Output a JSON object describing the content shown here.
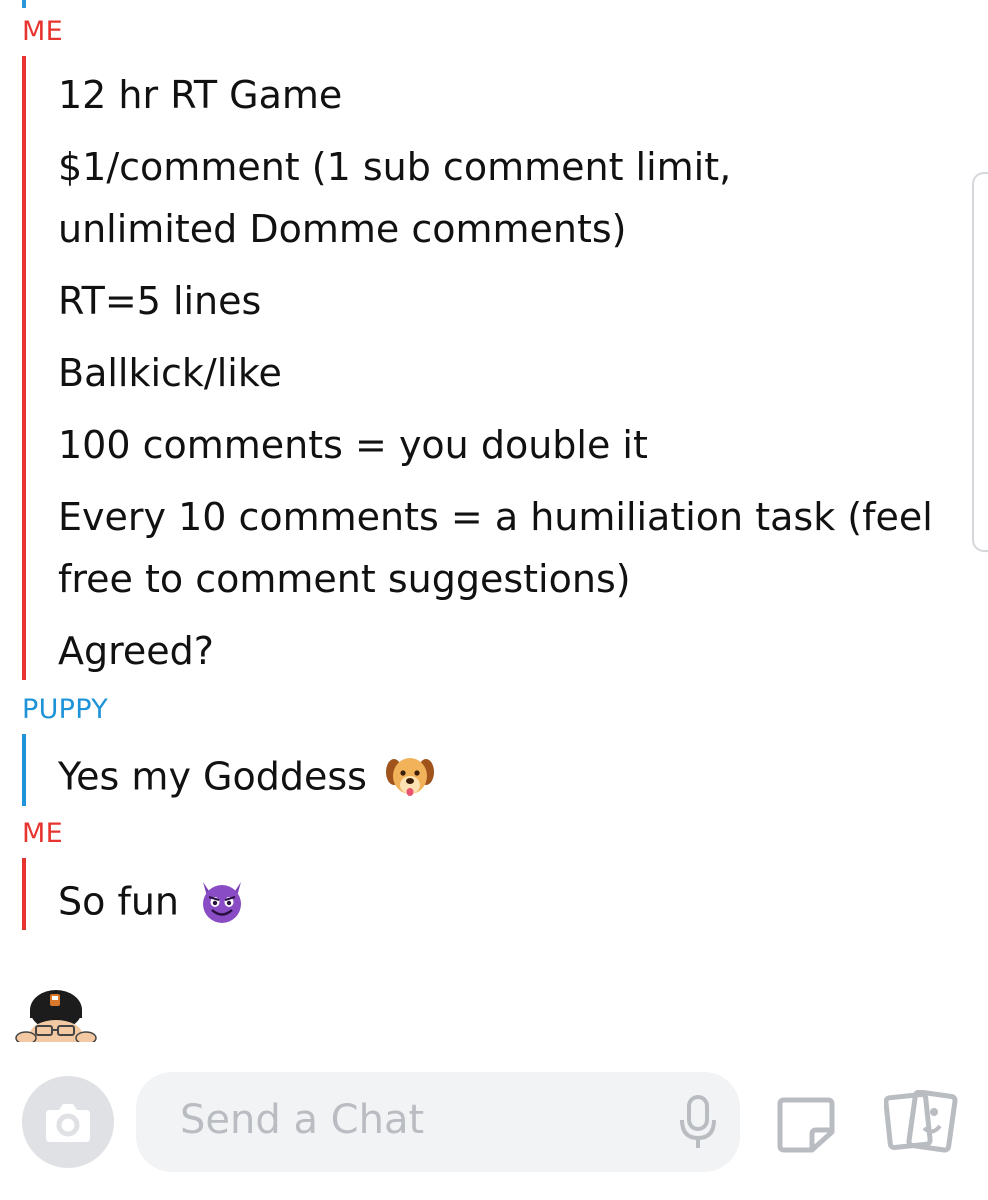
{
  "conversation": {
    "groups": [
      {
        "sender": "ME",
        "lines": [
          "12 hr RT Game",
          "$1/comment (1 sub comment limit,",
          "unlimited Domme comments)",
          "RT=5 lines",
          "Ballkick/like",
          "100 comments = you double it",
          "Every 10 comments = a humiliation task (feel",
          "free to comment suggestions)",
          "Agreed?"
        ]
      },
      {
        "sender": "PUPPY",
        "lines": [
          "Yes my Goddess"
        ],
        "emoji": "dog-face-emoji"
      },
      {
        "sender": "ME",
        "lines": [
          "So fun"
        ],
        "emoji": "smiling-devil-emoji"
      }
    ]
  },
  "composer": {
    "placeholder": "Send a Chat"
  },
  "icons": {
    "camera": "camera-icon",
    "microphone": "microphone-icon",
    "sticker": "sticker-icon",
    "memories": "memories-icon"
  },
  "colors": {
    "me": "#e8342f",
    "friend": "#1f93d8",
    "text": "#111111",
    "input_bg": "#f2f3f5",
    "camera_bg": "#dfe1e5"
  }
}
